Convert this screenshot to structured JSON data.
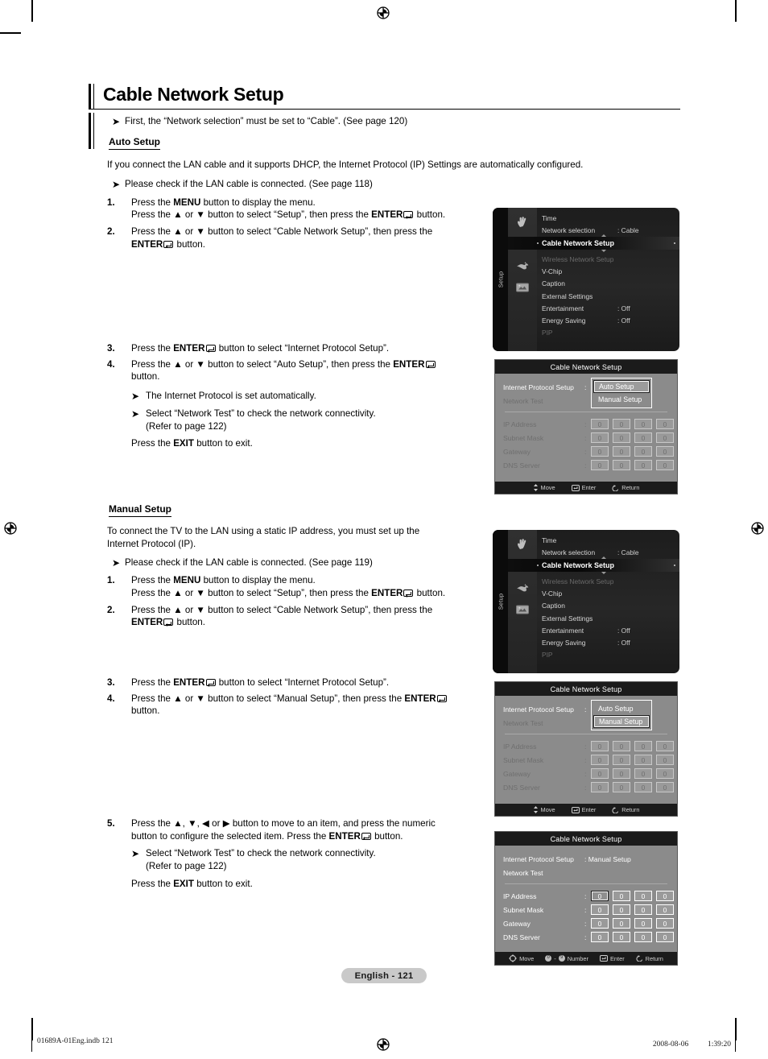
{
  "page": {
    "title": "Cable Network Setup",
    "page_tag": "English - 121",
    "footer_left": "01689A-01Eng.indb   121",
    "footer_right": "2008-08-06  　　 1:39:20"
  },
  "intro": {
    "bullet": "First, the “Network selection” must be set to “Cable”. (See page 120)"
  },
  "auto": {
    "heading": "Auto Setup",
    "lead": "If you connect the LAN cable and it supports DHCP, the Internet Protocol (IP) Settings are automatically configured.",
    "check": "Please check if the LAN cable is connected. (See page 118)",
    "step1_a": "Press the ",
    "step1_menu": "MENU",
    "step1_b": " button to display the menu.",
    "step1_c": "Press the ▲ or ▼ button to select “Setup”, then press the ",
    "step1_enter": "ENTER",
    "step1_d": " button.",
    "step2_a": "Press the ▲ or ▼ button to select “Cable Network Setup”, then press the ",
    "step2_enter": "ENTER",
    "step2_b": " button.",
    "step3_a": "Press the ",
    "step3_enter": "ENTER",
    "step3_b": " button to select “Internet Protocol Setup”.",
    "step4_a": "Press the ▲ or ▼ button to select “Auto Setup”, then press the ",
    "step4_enter": "ENTER",
    "step4_b": " button.",
    "note1": "The Internet Protocol is set automatically.",
    "note2_l1": "Select “Network Test” to check the network connectivity.",
    "note2_l2": "(Refer to page 122)",
    "exit_a": "Press the ",
    "exit_key": "EXIT",
    "exit_b": " button to exit."
  },
  "manual": {
    "heading": "Manual Setup",
    "lead_l1": "To connect the TV to the LAN using a static IP address, you must set up the",
    "lead_l2": "Internet Protocol (IP).",
    "check": "Please check if the LAN cable is connected. (See page 119)",
    "step1_a": "Press the ",
    "step1_menu": "MENU",
    "step1_b": " button to display the menu.",
    "step1_c": "Press the ▲ or ▼ button to select “Setup”, then press the ",
    "step1_enter": "ENTER",
    "step1_d": " button.",
    "step2_a": "Press the ▲ or ▼ button to select “Cable Network Setup”, then press the ",
    "step2_enter": "ENTER",
    "step2_b": " button.",
    "step3_a": "Press the ",
    "step3_enter": "ENTER",
    "step3_b": " button to select “Internet Protocol Setup”.",
    "step4_a": "Press the ▲ or ▼ button to select “Manual Setup”, then press the ",
    "step4_enter": "ENTER",
    "step4_b": " button.",
    "step5_a": "Press the ▲, ▼, ◀ or ▶ button to move to an item, and press the numeric",
    "step5_b": "button to configure the selected item. Press the ",
    "step5_enter": "ENTER",
    "step5_c": " button.",
    "note_l1": "Select “Network Test” to check the network connectivity.",
    "note_l2": "(Refer to page 122)",
    "exit_a": "Press the ",
    "exit_key": "EXIT",
    "exit_b": " button to exit."
  },
  "osd_menu": {
    "sidebar_label": "Setup",
    "rows": [
      {
        "label": "Time",
        "value": "",
        "state": "normal"
      },
      {
        "label": "Network selection",
        "value": ": Cable",
        "state": "normal"
      },
      {
        "label": "Cable Network Setup",
        "value": "",
        "state": "selected"
      },
      {
        "label": "Wireless Network Setup",
        "value": "",
        "state": "disabled"
      },
      {
        "label": "V-Chip",
        "value": "",
        "state": "normal"
      },
      {
        "label": "Caption",
        "value": "",
        "state": "normal"
      },
      {
        "label": "External Settings",
        "value": "",
        "state": "normal"
      },
      {
        "label": "Entertainment",
        "value": ": Off",
        "state": "normal"
      },
      {
        "label": "Energy Saving",
        "value": ": Off",
        "state": "normal"
      },
      {
        "label": "PIP",
        "value": "",
        "state": "disabled"
      }
    ],
    "icons": [
      "hand-icon",
      "gear-icon",
      "plug-icon",
      "screen-icon"
    ]
  },
  "osd_dialog": {
    "title": "Cable Network Setup",
    "row_ip_setup_label": "Internet Protocol Setup",
    "row_network_test_label": "Network Test",
    "colon": ":",
    "popup_options": [
      "Auto Setup",
      "Manual Setup"
    ],
    "fields": [
      {
        "label": "IP Address",
        "octets": [
          "0",
          "0",
          "0",
          "0"
        ]
      },
      {
        "label": "Subnet Mask",
        "octets": [
          "0",
          "0",
          "0",
          "0"
        ]
      },
      {
        "label": "Gateway",
        "octets": [
          "0",
          "0",
          "0",
          "0"
        ]
      },
      {
        "label": "DNS Server",
        "octets": [
          "0",
          "0",
          "0",
          "0"
        ]
      }
    ],
    "footer_move": "Move",
    "footer_number": "Number",
    "footer_number_keys": "0-9",
    "footer_enter": "Enter",
    "footer_return": "Return",
    "manual_selected_value": ": Manual Setup"
  },
  "colors": {
    "osd_dark": "#1b1b1b",
    "osd_panel": "#8b8b8b",
    "page_tag_bg": "#c9c9c9"
  }
}
